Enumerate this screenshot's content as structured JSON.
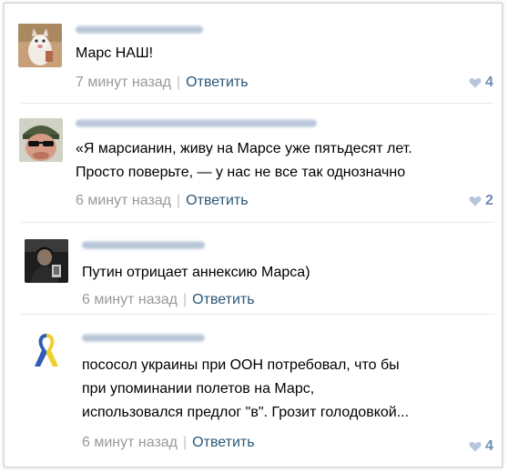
{
  "comments": [
    {
      "text": [
        "Марс НАШ!"
      ],
      "time": "7 минут назад",
      "separator": "|",
      "reply": "Ответить",
      "likes": "4",
      "avatar": "kitten-photo"
    },
    {
      "text": [
        "«Я марсианин, живу на Марсе уже пятьдесят лет.",
        "Просто поверьте, — у нас не все так однозначно"
      ],
      "time": "6 минут назад",
      "separator": "|",
      "reply": "Ответить",
      "likes": "2",
      "avatar": "man-with-sunglasses"
    },
    {
      "text": [
        "Путин отрицает аннексию Марса)"
      ],
      "time": "6 минут назад",
      "separator": "|",
      "reply": "Ответить",
      "avatar": "dark-portrait"
    },
    {
      "text": [
        "пососол украины при ООН потребовал, что бы",
        "при упоминании полетов на Марс,",
        "использовался предлог \"в\". Грозит голодовкой..."
      ],
      "time": "6 минут назад",
      "separator": "|",
      "reply": "Ответить",
      "likes": "4",
      "avatar": "blue-yellow-ribbon"
    }
  ],
  "colors": {
    "link": "#2b587a",
    "meta": "#999999",
    "likes": "#6f8eb3",
    "divider": "#e7e9ec"
  },
  "icons": {
    "like": "heart-icon"
  }
}
